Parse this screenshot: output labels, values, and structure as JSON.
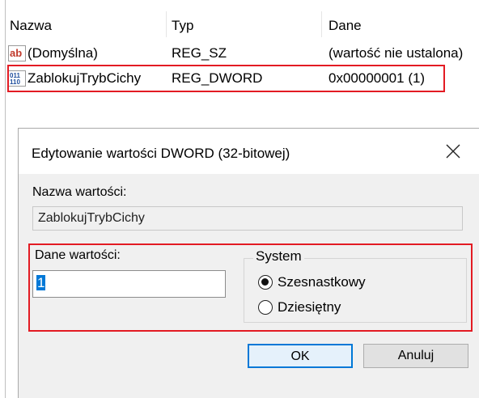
{
  "list": {
    "headers": {
      "name": "Nazwa",
      "type": "Typ",
      "data": "Dane"
    },
    "rows": [
      {
        "icon": "string-value-icon",
        "name": "(Domyślna)",
        "type": "REG_SZ",
        "data": "(wartość nie ustalona)"
      },
      {
        "icon": "binary-value-icon",
        "name": "ZablokujTrybCichy",
        "type": "REG_DWORD",
        "data": "0x00000001 (1)"
      }
    ]
  },
  "dialog": {
    "title": "Edytowanie wartości DWORD (32-bitowej)",
    "value_name_label": "Nazwa wartości:",
    "value_name": "ZablokujTrybCichy",
    "value_data_label": "Dane wartości:",
    "value_data": "1",
    "base_label": "System",
    "base_options": [
      {
        "label": "Szesnastkowy",
        "selected": true
      },
      {
        "label": "Dziesiętny",
        "selected": false
      }
    ],
    "ok_label": "OK",
    "cancel_label": "Anuluj"
  },
  "colors": {
    "highlight": "#e31b23",
    "accent": "#0078d7",
    "dialog_bg": "#f0f0f0"
  }
}
